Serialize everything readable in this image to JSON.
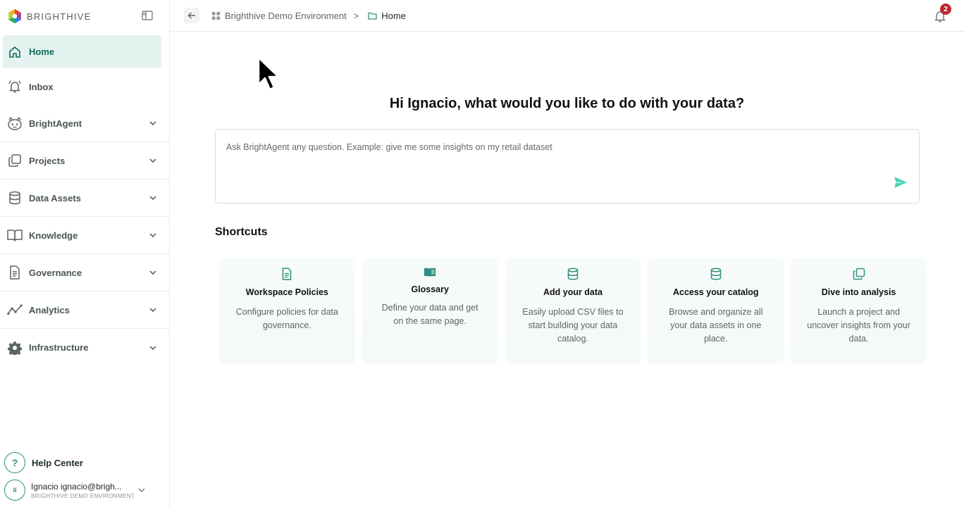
{
  "brand": {
    "name": "BRIGHTHIVE"
  },
  "sidebar": {
    "items": [
      {
        "label": "Home",
        "icon": "home-icon"
      },
      {
        "label": "Inbox",
        "icon": "bell-icon"
      },
      {
        "label": "BrightAgent",
        "icon": "robot-icon"
      },
      {
        "label": "Projects",
        "icon": "copy-icon"
      },
      {
        "label": "Data Assets",
        "icon": "database-icon"
      },
      {
        "label": "Knowledge",
        "icon": "book-open-icon"
      },
      {
        "label": "Governance",
        "icon": "document-icon"
      },
      {
        "label": "Analytics",
        "icon": "trend-icon"
      },
      {
        "label": "Infrastructure",
        "icon": "gear-icon"
      }
    ],
    "help": {
      "label": "Help Center",
      "glyph": "?"
    },
    "user": {
      "initials": "II",
      "name": "Ignacio ignacio@brigh...",
      "env": "BRIGHTHIVE DEMO ENVIRONMENT"
    }
  },
  "breadcrumb": {
    "items": [
      "Brighthive Demo Environment",
      "Home"
    ],
    "separator": ">"
  },
  "notifications": {
    "count": "2"
  },
  "main": {
    "greeting": "Hi Ignacio, what would you like to do with your data?",
    "ask_placeholder": "Ask BrightAgent any question. Example: give me some insights on my retail dataset",
    "shortcuts_title": "Shortcuts",
    "shortcuts": [
      {
        "title": "Workspace Policies",
        "desc": "Configure policies for data governance.",
        "icon": "document-icon"
      },
      {
        "title": "Glossary",
        "desc": "Define your data and get on the same page.",
        "icon": "book-icon"
      },
      {
        "title": "Add your data",
        "desc": "Easily upload CSV files to start building your data catalog.",
        "icon": "database-icon"
      },
      {
        "title": "Access your catalog",
        "desc": "Browse and organize all your data assets in one place.",
        "icon": "database-icon"
      },
      {
        "title": "Dive into analysis",
        "desc": "Launch a project and uncover insights from your data.",
        "icon": "copy-icon"
      }
    ]
  },
  "colors": {
    "accent": "#2f8f7e",
    "active_bg": "#e4f3ef",
    "badge": "#c0262f",
    "send": "#4fd1b5"
  }
}
